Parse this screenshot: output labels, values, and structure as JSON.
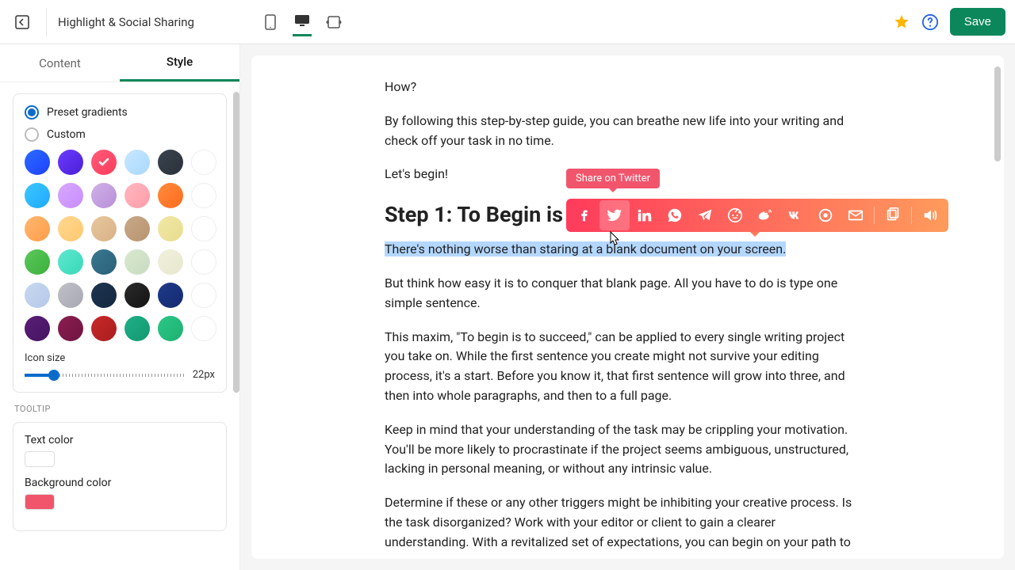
{
  "header": {
    "title": "Highlight & Social Sharing",
    "save_label": "Save"
  },
  "sidebar": {
    "tabs": {
      "content": "Content",
      "style": "Style"
    },
    "gradient": {
      "preset_label": "Preset gradients",
      "custom_label": "Custom",
      "swatches": [
        {
          "bg": "linear-gradient(135deg,#2b6cff,#1e40ff)"
        },
        {
          "bg": "linear-gradient(135deg,#6a3cff,#4b1ed6)"
        },
        {
          "bg": "linear-gradient(135deg,#ff5c7a,#ff3b5c)",
          "selected": true
        },
        {
          "bg": "linear-gradient(135deg,#c8e8ff,#a8d8ff)"
        },
        {
          "bg": "linear-gradient(135deg,#3a4450,#2a3038)"
        },
        {
          "bg": "#ffffff"
        },
        {
          "bg": "linear-gradient(135deg,#3bc8ff,#1ea8ff)"
        },
        {
          "bg": "linear-gradient(135deg,#d8a8ff,#c88cff)"
        },
        {
          "bg": "linear-gradient(135deg,#d0b0e8,#b890d8)"
        },
        {
          "bg": "linear-gradient(135deg,#ffb8c0,#ff9ca8)"
        },
        {
          "bg": "linear-gradient(135deg,#ff8c3c,#ff6a1e)"
        },
        {
          "bg": "#ffffff"
        },
        {
          "bg": "linear-gradient(135deg,#ffb870,#ff9c4a)"
        },
        {
          "bg": "linear-gradient(135deg,#ffd890,#ffc870)"
        },
        {
          "bg": "linear-gradient(135deg,#e8c89c,#d8b088)"
        },
        {
          "bg": "linear-gradient(135deg,#c8a888,#b89470)"
        },
        {
          "bg": "linear-gradient(135deg,#f0e8a8,#e8dc8c)"
        },
        {
          "bg": "#ffffff"
        },
        {
          "bg": "linear-gradient(135deg,#5cc85c,#3ab03a)"
        },
        {
          "bg": "linear-gradient(135deg,#5ce8d0,#3ad8b8)"
        },
        {
          "bg": "linear-gradient(135deg,#3a7890,#2a6078)"
        },
        {
          "bg": "linear-gradient(135deg,#d8e8d0,#c8dcc0)"
        },
        {
          "bg": "linear-gradient(135deg,#f0f0dc,#e8e8d0)"
        },
        {
          "bg": "#ffffff"
        },
        {
          "bg": "linear-gradient(135deg,#c8d8f0,#b4c8e8)"
        },
        {
          "bg": "linear-gradient(135deg,#c0c0c8,#a8a8b4)"
        },
        {
          "bg": "linear-gradient(135deg,#1e3450,#142840)"
        },
        {
          "bg": "linear-gradient(135deg,#2a2a2a,#141414)"
        },
        {
          "bg": "linear-gradient(135deg,#1e3a8a,#142a70)"
        },
        {
          "bg": "#ffffff"
        },
        {
          "bg": "linear-gradient(135deg,#5a1e78,#441460)"
        },
        {
          "bg": "linear-gradient(135deg,#8a1e50,#701440)"
        },
        {
          "bg": "linear-gradient(135deg,#c82828,#a81e1e)"
        },
        {
          "bg": "linear-gradient(135deg,#1eb088,#149870)"
        },
        {
          "bg": "linear-gradient(135deg,#2ac888,#1eb070)"
        },
        {
          "bg": "#ffffff"
        }
      ]
    },
    "icon_size": {
      "label": "Icon size",
      "value": "22px"
    },
    "tooltip_section": {
      "header": "TOOLTIP",
      "text_color_label": "Text color",
      "text_color": "#ffffff",
      "bg_color_label": "Background color",
      "bg_color": "#f1556c"
    }
  },
  "preview": {
    "paragraphs": {
      "p1": "How?",
      "p2": "By following this step-by-step guide, you can breathe new life into your writing and check off your task in no time.",
      "p3": "Let's begin!",
      "h2": "Step 1: To Begin is to Succeed",
      "p4_highlighted": "There's nothing worse than staring at a blank document on your screen.",
      "p5": "But think how easy it is to conquer that blank page. All you have to do is type one simple sentence.",
      "p6": "This maxim, \"To begin is to succeed,\" can be applied to every single writing project you take on. While the first sentence you create might not survive your editing process, it's a start. Before you know it, that first sentence will grow into three, and then into whole paragraphs, and then to a full page.",
      "p7": "Keep in mind that your understanding of the task may be crippling your motivation. You'll be more likely to procrastinate if the project seems ambiguous, unstructured, lacking in personal meaning, or without any intrinsic value.",
      "p8": "Determine if these or any other triggers might be inhibiting your creative process. Is the task disorganized? Work with your editor or client to gain a clearer understanding. With a revitalized set of expectations, you can begin on your path to success."
    },
    "sharebar": {
      "tooltip": "Share on Twitter",
      "icons": [
        "facebook",
        "twitter",
        "linkedin",
        "whatsapp",
        "telegram",
        "reddit",
        "weibo",
        "vk",
        "messenger",
        "email",
        "copy",
        "speak"
      ]
    }
  }
}
